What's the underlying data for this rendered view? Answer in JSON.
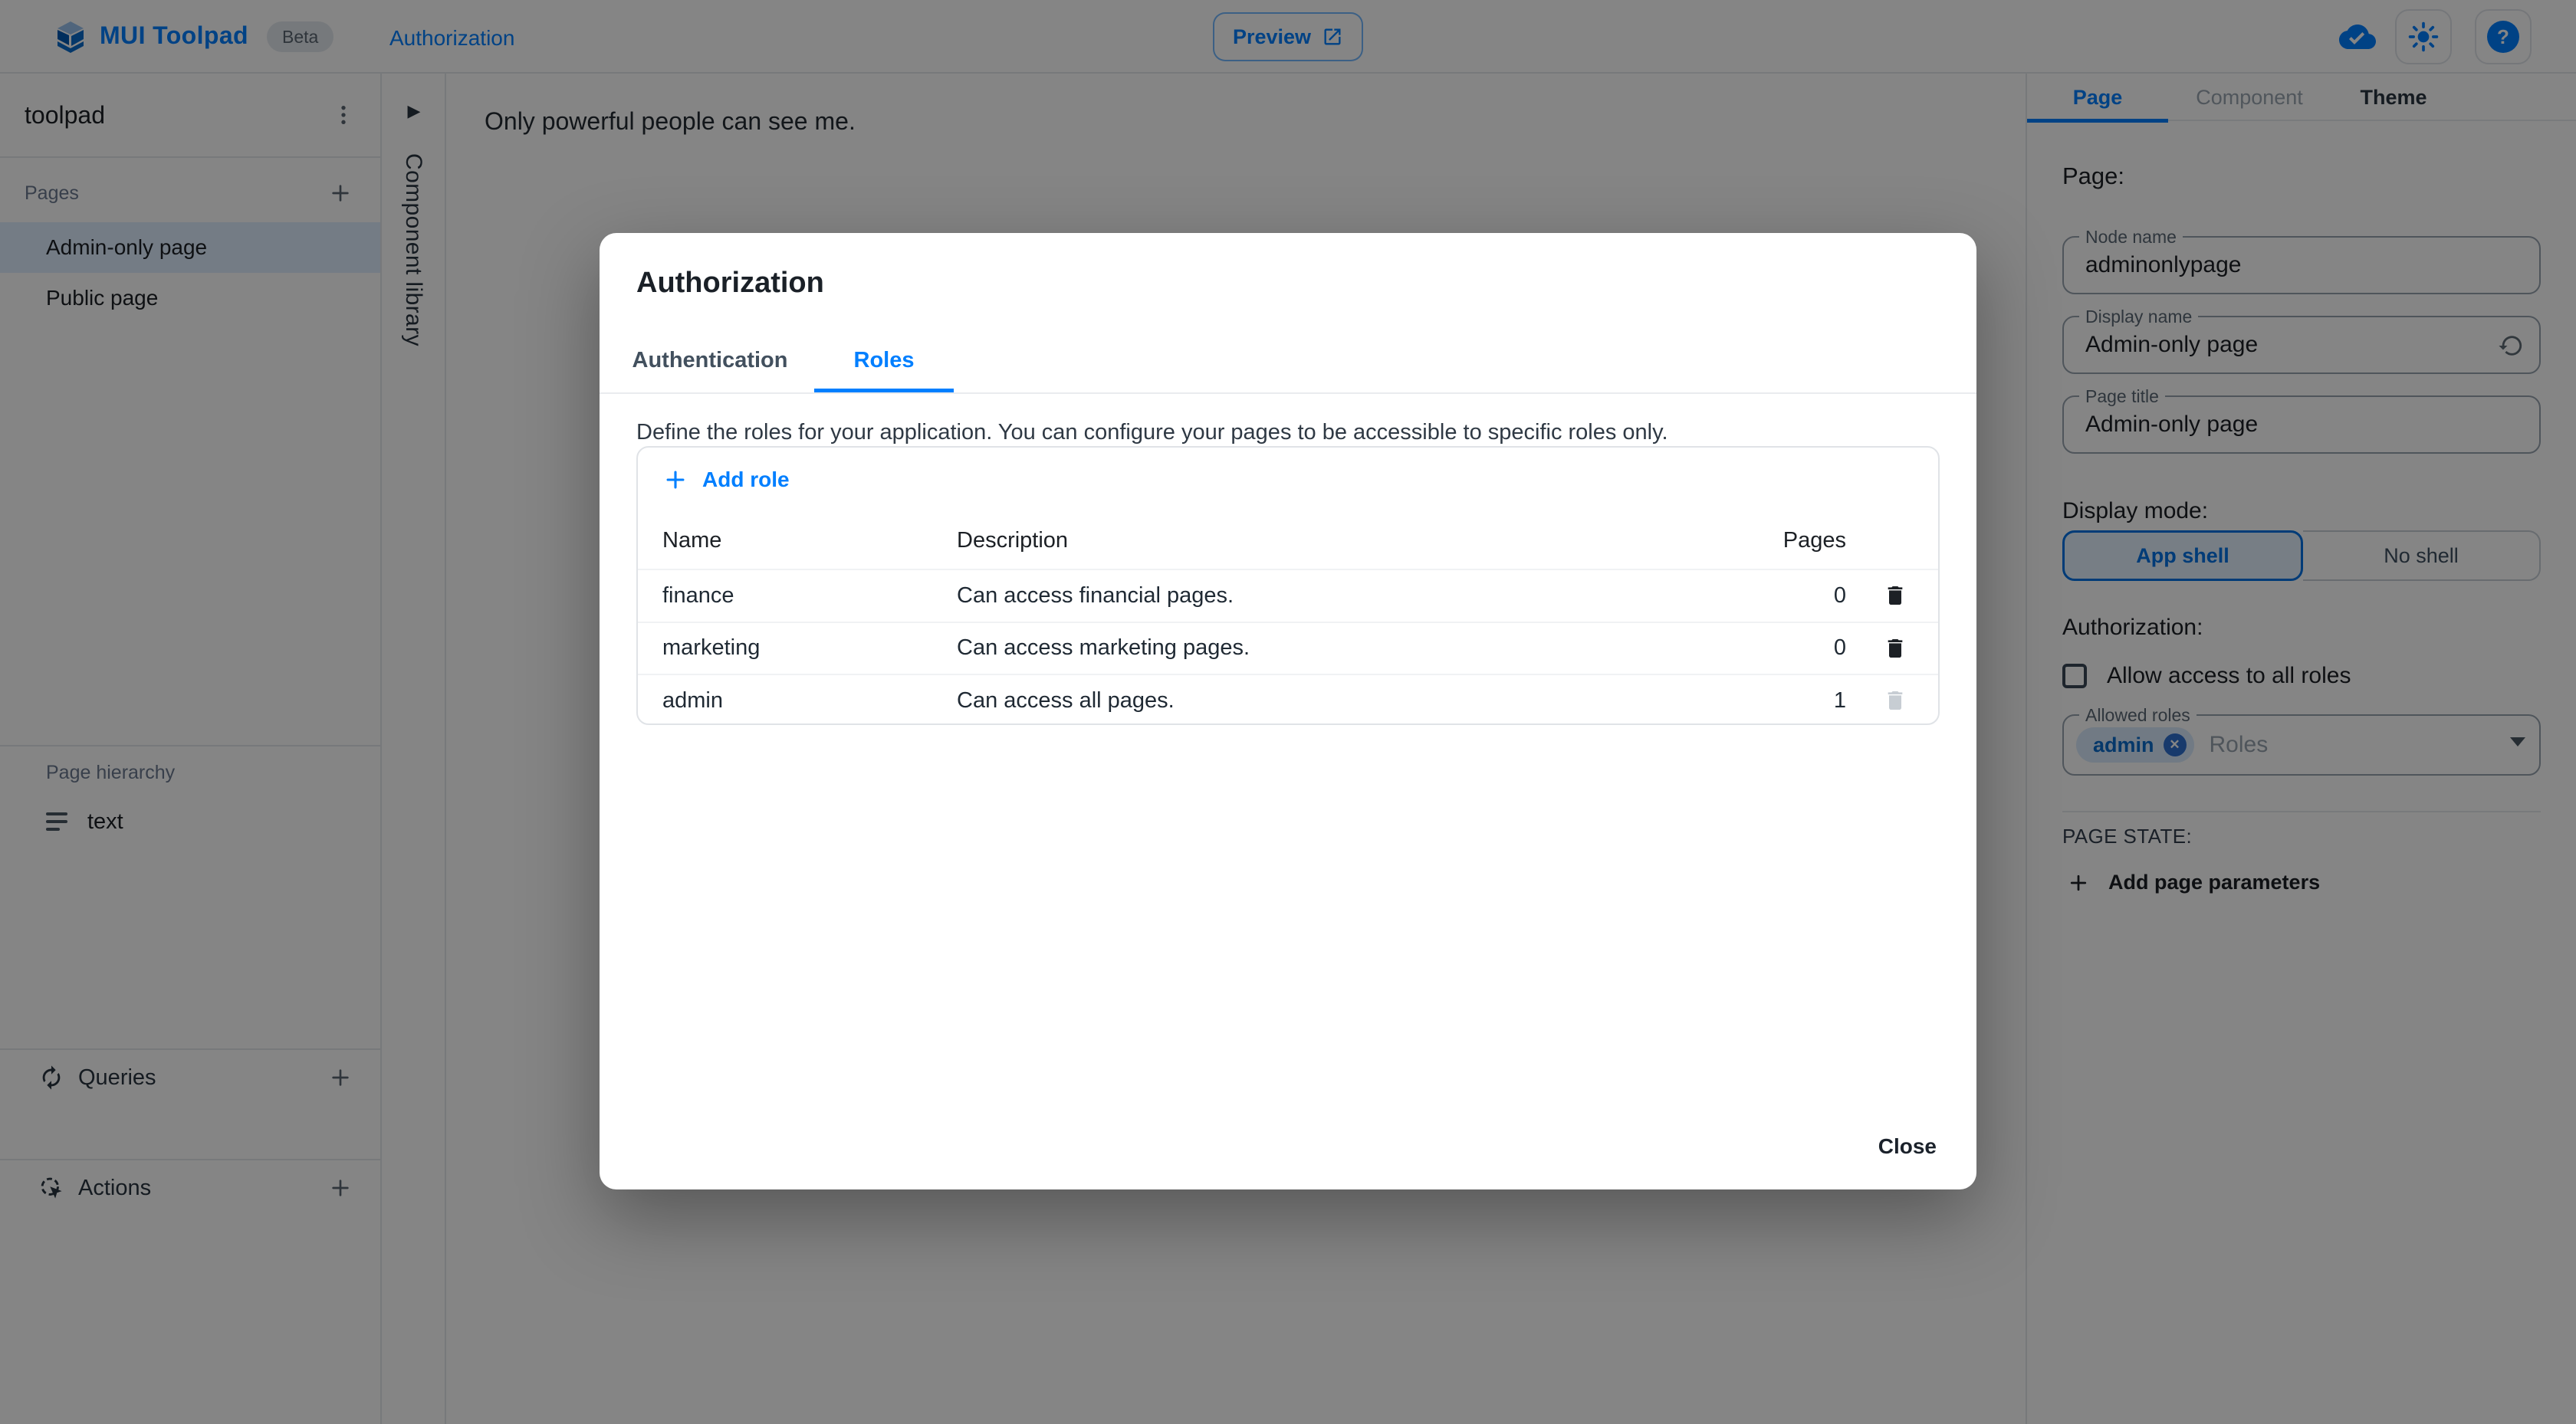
{
  "colors": {
    "primary": "#007FFF",
    "selected_row_bg": "rgba(0,127,255,0.13)",
    "backdrop": "rgba(0,0,0,0.48)"
  },
  "header": {
    "app_name": "MUI Toolpad",
    "beta_badge": "Beta",
    "breadcrumb": "Authorization",
    "preview_button": "Preview"
  },
  "sidebar": {
    "project_name": "toolpad",
    "pages_label": "Pages",
    "pages": [
      {
        "label": "Admin-only page",
        "selected": true
      },
      {
        "label": "Public page",
        "selected": false
      }
    ],
    "hierarchy_label": "Page hierarchy",
    "hierarchy_items": [
      {
        "label": "text"
      }
    ],
    "queries_label": "Queries",
    "actions_label": "Actions"
  },
  "component_library": {
    "label": "Component library"
  },
  "canvas": {
    "text": "Only powerful people can see me."
  },
  "dialog": {
    "title": "Authorization",
    "tabs": [
      {
        "label": "Authentication"
      },
      {
        "label": "Roles"
      }
    ],
    "active_tab": "Roles",
    "description": "Define the roles for your application. You can configure your pages to be accessible to specific roles only.",
    "add_role_label": "Add role",
    "table": {
      "headers": {
        "name": "Name",
        "description": "Description",
        "pages": "Pages"
      },
      "rows": [
        {
          "name": "finance",
          "description": "Can access financial pages.",
          "pages": "0",
          "delete_enabled": true
        },
        {
          "name": "marketing",
          "description": "Can access marketing pages.",
          "pages": "0",
          "delete_enabled": true
        },
        {
          "name": "admin",
          "description": "Can access all pages.",
          "pages": "1",
          "delete_enabled": false
        }
      ]
    },
    "close_button": "Close"
  },
  "inspector": {
    "tabs": [
      {
        "label": "Page"
      },
      {
        "label": "Component"
      },
      {
        "label": "Theme"
      }
    ],
    "active_tab": "Page",
    "heading": "Page:",
    "fields": {
      "node_name": {
        "label": "Node name",
        "value": "adminonlypage"
      },
      "display_name": {
        "label": "Display name",
        "value": "Admin-only page"
      },
      "page_title": {
        "label": "Page title",
        "value": "Admin-only page"
      }
    },
    "display_mode": {
      "label": "Display mode:",
      "options": [
        {
          "label": "App shell"
        },
        {
          "label": "No shell"
        }
      ],
      "selected": "App shell"
    },
    "authorization": {
      "label": "Authorization:",
      "checkbox_label": "Allow access to all roles",
      "checked": false,
      "allowed_roles": {
        "label": "Allowed roles",
        "chips": [
          "admin"
        ],
        "placeholder": "Roles"
      }
    },
    "page_state_label": "PAGE STATE:",
    "add_page_parameters_label": "Add page parameters"
  }
}
